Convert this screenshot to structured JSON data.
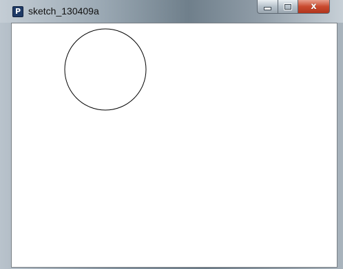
{
  "window": {
    "title": "sketch_130409a",
    "app_icon_letter": "P",
    "app_icon_name": "processing-icon"
  },
  "caption_buttons": {
    "minimize_icon": "minimize-icon",
    "maximize_icon": "maximize-icon",
    "close_icon": "close-icon",
    "close_glyph": "x"
  },
  "canvas": {
    "background": "#ffffff",
    "shapes": [
      {
        "type": "circle",
        "stroke": "#000000",
        "fill": "none"
      }
    ]
  }
}
